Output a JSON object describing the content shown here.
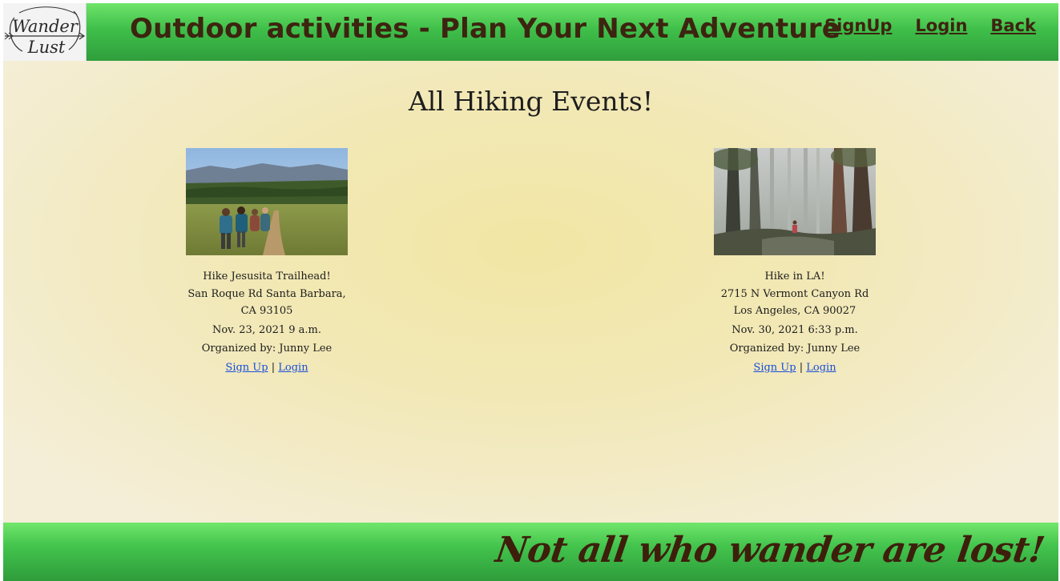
{
  "header": {
    "logo_text": [
      "Wander",
      "Lust"
    ],
    "title": "Outdoor activities - Plan Your Next Adventure",
    "nav": {
      "signup": "SignUp",
      "login": "Login",
      "back": "Back"
    }
  },
  "main": {
    "heading": "All Hiking Events!",
    "events": [
      {
        "name": "Hike Jesusita Trailhead!",
        "address_line1": "San Roque Rd Santa Barbara,",
        "address_line2": "CA 93105",
        "datetime": "Nov. 23, 2021 9 a.m.",
        "organizer": "Organized by: Junny Lee",
        "signup_label": "Sign Up",
        "separator": "|",
        "login_label": "Login"
      },
      {
        "name": "Hike in LA!",
        "address_line1": "2715 N Vermont Canyon Rd",
        "address_line2": "Los Angeles, CA 90027",
        "datetime": "Nov. 30, 2021 6:33 p.m.",
        "organizer": "Organized by: Junny Lee",
        "signup_label": "Sign Up",
        "separator": "|",
        "login_label": "Login"
      }
    ]
  },
  "footer": {
    "quote": "Not all who wander are lost!"
  },
  "colors": {
    "header_green": "#3fbf4a",
    "title_brown": "#3d2410",
    "link_blue": "#1a4fd8",
    "background_cream": "#f2e8b6"
  }
}
